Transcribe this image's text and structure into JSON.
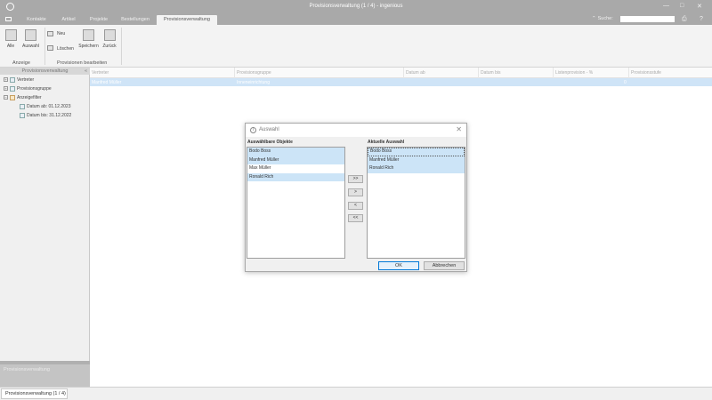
{
  "window": {
    "title": "Provisionsverwaltung (1 / 4) - ingenious",
    "controls": {
      "minimize": "—",
      "maximize": "□",
      "close": "✕"
    }
  },
  "menu": {
    "tabs": [
      {
        "label": "Kontakte"
      },
      {
        "label": "Artikel"
      },
      {
        "label": "Projekte"
      },
      {
        "label": "Bestellungen"
      },
      {
        "label": "Provisionsverwaltung"
      }
    ],
    "active_tab": "Provisionsverwaltung",
    "search_label": "Suche:",
    "search_value": "",
    "print_icon": "⎙",
    "help_icon": "?"
  },
  "ribbon": {
    "group_view": {
      "label": "Anzeige",
      "buttons": {
        "all": "Alle",
        "selection": "Auswahl"
      }
    },
    "group_edit": {
      "label": "Provisionen bearbeiten",
      "buttons": {
        "new": "Neu",
        "delete": "Löschen",
        "save": "Speichern",
        "back": "Zurück"
      }
    }
  },
  "left_panel": {
    "header": "Provisionsverwaltung",
    "collapse_glyph": "«",
    "tree": [
      {
        "label": "Vertreter",
        "expander": "+"
      },
      {
        "label": "Provisionsgruppe",
        "expander": "+"
      },
      {
        "label": "Anzeigefilter",
        "expander": "−"
      },
      {
        "label": "Datum ab: 01.12.2023"
      },
      {
        "label": "Datum bis: 31.12.2022"
      }
    ],
    "footer_label": "Provisionsverwaltung"
  },
  "grid": {
    "columns": [
      "Vertreter",
      "Provisionsgruppe",
      "Datum ab",
      "Datum bis",
      "Listenprovision - %",
      "Provisionsstufe"
    ],
    "rows": [
      {
        "vertreter": "Manfred Müller",
        "gruppe": "Inneneinrichtung",
        "stufe": "0"
      }
    ]
  },
  "status_bar": {
    "tab_label": "Provisionsverwaltung (1 / 4)"
  },
  "dialog": {
    "title": "Auswahl",
    "info_icon": "i",
    "close_glyph": "✕",
    "available_label": "Auswählbare Objekte",
    "available_items": [
      {
        "label": "Bodo Boss",
        "selected": true
      },
      {
        "label": "Manfred Müller",
        "selected": true
      },
      {
        "label": "Max Müller",
        "selected": false
      },
      {
        "label": "Ronald Rich",
        "selected": true
      }
    ],
    "current_label": "Aktuelle Auswahl",
    "current_items": [
      {
        "label": "Bodo Boss",
        "selected": true
      },
      {
        "label": "Manfred Müller",
        "selected": true
      },
      {
        "label": "Ronald Rich",
        "selected": true
      }
    ],
    "move_buttons": {
      "add_all": ">>",
      "add": ">",
      "remove": "<",
      "remove_all": "<<"
    },
    "ok_label": "OK",
    "cancel_label": "Abbrechen"
  },
  "colors": {
    "chrome_gray": "#a9a9a9",
    "selection_blue": "#cce4f7",
    "row_selection": "#cfe4f7",
    "focus_border": "#0078d7"
  }
}
